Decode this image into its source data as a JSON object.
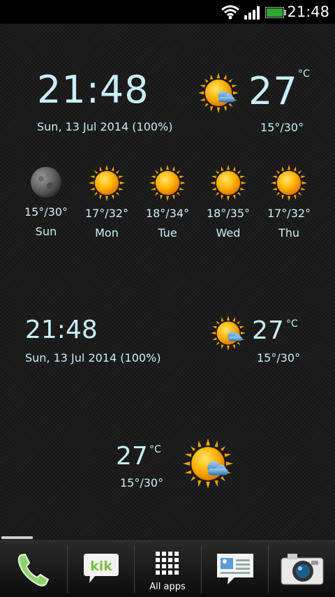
{
  "status_bar": {
    "time": "21:48",
    "battery_color": "#2ea82e"
  },
  "widget_large": {
    "time": "21:48",
    "date": "Sun, 13 Jul 2014",
    "battery": "(100%)",
    "temp": "27",
    "unit": "°C",
    "range": "15°/30°",
    "icon": "sun-cloud-icon"
  },
  "forecast": [
    {
      "range": "15°/30°",
      "day": "Sun",
      "icon": "moon-icon"
    },
    {
      "range": "17°/32°",
      "day": "Mon",
      "icon": "sun-icon"
    },
    {
      "range": "18°/34°",
      "day": "Tue",
      "icon": "sun-icon"
    },
    {
      "range": "18°/35°",
      "day": "Wed",
      "icon": "sun-icon"
    },
    {
      "range": "17°/32°",
      "day": "Thu",
      "icon": "sun-icon"
    }
  ],
  "widget_medium": {
    "time": "21:48",
    "date": "Sun, 13 Jul 2014",
    "battery": "(100%)",
    "temp": "27",
    "unit": "°C",
    "range": "15°/30°",
    "icon": "sun-cloud-icon"
  },
  "widget_small": {
    "temp": "27",
    "unit": "°C",
    "range": "15°/30°",
    "icon": "sun-cloud-icon"
  },
  "dock": {
    "items": [
      {
        "name": "phone-icon"
      },
      {
        "name": "kik-icon",
        "label": "kik"
      },
      {
        "name": "all-apps-icon",
        "label": "All apps"
      },
      {
        "name": "messages-icon"
      },
      {
        "name": "camera-icon"
      }
    ]
  }
}
